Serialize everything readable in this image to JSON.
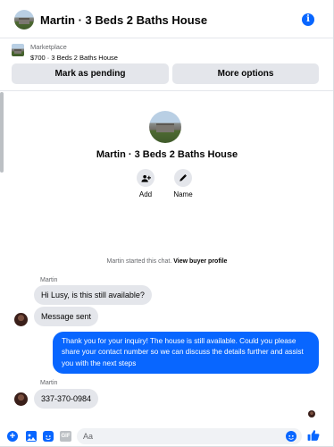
{
  "header": {
    "title": "Martin · 3 Beds 2 Baths House",
    "info_icon": "info-icon",
    "info_glyph": "i"
  },
  "marketplace": {
    "label": "Marketplace",
    "listing": "$700 · 3 Beds 2 Baths House",
    "mark_pending_label": "Mark as pending",
    "more_options_label": "More options"
  },
  "profile": {
    "name": "Martin · 3 Beds 2 Baths House",
    "actions": [
      {
        "label": "Add",
        "icon": "add-person-icon"
      },
      {
        "label": "Name",
        "icon": "pencil-icon"
      }
    ]
  },
  "started": {
    "text": "Martin started this chat.",
    "link": "View buyer profile"
  },
  "messages": [
    {
      "sender": "Martin",
      "text": "Hi Lusy, is this still available?",
      "direction": "in"
    },
    {
      "text": "Message sent",
      "direction": "in"
    },
    {
      "text": "Thank you for your inquiry! The house is still available. Could you please share your contact number so we can discuss the details further and assist you with the next steps",
      "direction": "out"
    },
    {
      "sender": "Martin",
      "text": "337-370-0984",
      "direction": "in"
    }
  ],
  "composer": {
    "placeholder": "Aa",
    "gif_label": "GIF"
  },
  "colors": {
    "accent": "#0866ff",
    "bubble_in": "#e4e6eb",
    "secondary_text": "#65676b"
  }
}
